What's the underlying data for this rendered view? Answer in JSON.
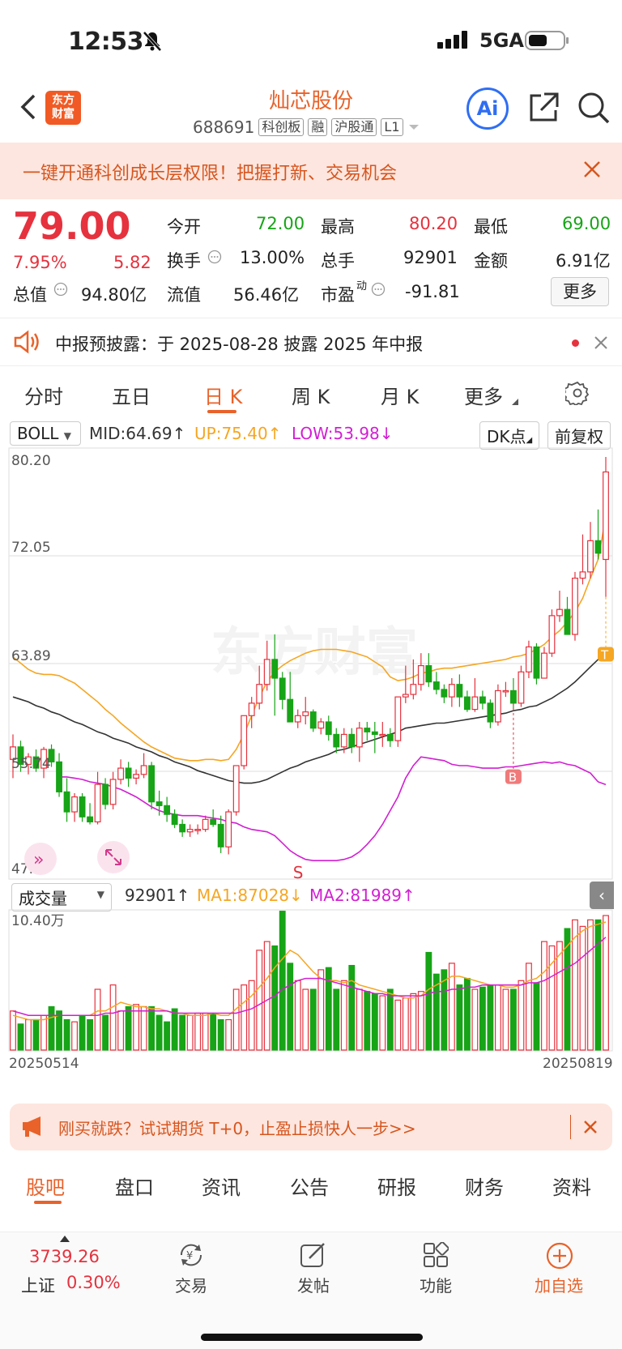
{
  "status": {
    "time": "12:53",
    "network": "5GA"
  },
  "nav": {
    "title": "灿芯股份",
    "code": "688691",
    "tags": [
      "科创板",
      "融",
      "沪股通",
      "L1"
    ],
    "logo": [
      "东方",
      "财富"
    ],
    "ai": "Ai"
  },
  "promo": {
    "text": "一键开通科创成长层权限！把握打新、交易机会"
  },
  "quote": {
    "price": "79.00",
    "pct": "7.95%",
    "chg": "5.82",
    "open_label": "今开",
    "open": "72.00",
    "high_label": "最高",
    "high": "80.20",
    "low_label": "最低",
    "low": "69.00",
    "turnover_label": "换手",
    "turnover": "13.00%",
    "vol_label": "总手",
    "vol": "92901",
    "amount_label": "金额",
    "amount": "6.91亿",
    "mktcap_label": "总值",
    "mktcap": "94.80亿",
    "float_label": "流值",
    "float": "56.46亿",
    "pe_label": "市盈",
    "pe_sup": "动",
    "pe": "-91.81",
    "more": "更多"
  },
  "notice": {
    "text": "中报预披露：于 2025-08-28 披露 2025 年中报"
  },
  "tabs": [
    "分时",
    "五日",
    "日 K",
    "周 K",
    "月 K",
    "更多"
  ],
  "indicator": {
    "name": "BOLL",
    "mid": "MID:64.69",
    "up": "UP:75.40",
    "low": "LOW:53.98",
    "dk": "DK点",
    "fq": "前复权"
  },
  "axis": {
    "y1": "80.20",
    "y2": "72.05",
    "y3": "63.89",
    "y4": "55.74",
    "y5": "47.59"
  },
  "marks": {
    "s": "S",
    "b": "B",
    "t": "T"
  },
  "watermark": "东方财富",
  "volume": {
    "name": "成交量",
    "val": "92901",
    "ma1": "MA1:87028",
    "ma2": "MA2:81989",
    "max": "10.40万",
    "start": "20250514",
    "end": "20250819"
  },
  "banner2": {
    "text": "刚买就跌？试试期货 T+0，止盈止损快人一步>>"
  },
  "bottom_tabs": [
    "股吧",
    "盘口",
    "资讯",
    "公告",
    "研报",
    "财务",
    "资料"
  ],
  "footer": {
    "index_val": "3739.26",
    "index_name": "上证",
    "index_pct": "0.30%",
    "trade": "交易",
    "post": "发帖",
    "func": "功能",
    "add": "加自选"
  },
  "colors": {
    "accent": "#e8622a",
    "up": "#e5323e",
    "down": "#17a417",
    "mid": "#333333",
    "upper": "#f5a623",
    "lower": "#d21fd2"
  },
  "chart_data": {
    "type": "candlestick",
    "ylim": [
      47.59,
      80.2
    ],
    "candles": [
      [
        56,
        58,
        54.5,
        57
      ],
      [
        57,
        57.5,
        55,
        55.6
      ],
      [
        55.6,
        56.5,
        54.8,
        56.2
      ],
      [
        56.2,
        56.8,
        55,
        55.3
      ],
      [
        55.3,
        57,
        54.5,
        56.8
      ],
      [
        56.8,
        57.2,
        55.4,
        55.8
      ],
      [
        55.8,
        56.5,
        53,
        53.4
      ],
      [
        53.4,
        54.5,
        51,
        51.8
      ],
      [
        51.8,
        53.3,
        51,
        53
      ],
      [
        53,
        53.3,
        51,
        51.4
      ],
      [
        51.4,
        52.5,
        50.8,
        51
      ],
      [
        51,
        55,
        50.8,
        54
      ],
      [
        54,
        54.5,
        52,
        52.4
      ],
      [
        52.4,
        55,
        52,
        54.4
      ],
      [
        54.4,
        56,
        54,
        55.3
      ],
      [
        55.3,
        55.8,
        53.8,
        54.5
      ],
      [
        54.5,
        55.2,
        54,
        54.8
      ],
      [
        54.8,
        56.5,
        54.5,
        55.5
      ],
      [
        55.5,
        55.8,
        52,
        52.6
      ],
      [
        52.6,
        53.5,
        51.5,
        52.3
      ],
      [
        52.3,
        53,
        51,
        51.6
      ],
      [
        51.6,
        52,
        50.5,
        50.8
      ],
      [
        50.8,
        51.2,
        49.8,
        50.2
      ],
      [
        50.2,
        50.8,
        49.8,
        50.4
      ],
      [
        50.4,
        50.8,
        50,
        50.4
      ],
      [
        50.4,
        51.5,
        50.2,
        51.2
      ],
      [
        51.2,
        52,
        50.6,
        50.8
      ],
      [
        50.8,
        51.5,
        48.5,
        49
      ],
      [
        49,
        52,
        48.4,
        51.8
      ],
      [
        51.8,
        55.5,
        51.5,
        55.5
      ],
      [
        55.5,
        59.5,
        55.2,
        59.5
      ],
      [
        59.5,
        61,
        58.5,
        60.5
      ],
      [
        60.5,
        63.5,
        60,
        62
      ],
      [
        62,
        65.5,
        61.5,
        64
      ],
      [
        64,
        66,
        59.5,
        62.5
      ],
      [
        62.5,
        63,
        60,
        60.8
      ],
      [
        60.8,
        63,
        60,
        59
      ],
      [
        59,
        60,
        58.5,
        59.5
      ],
      [
        59.5,
        61,
        58.8,
        59.8
      ],
      [
        59.8,
        60,
        58.2,
        58.5
      ],
      [
        58.5,
        59.3,
        58,
        59
      ],
      [
        59,
        59.5,
        57.5,
        58
      ],
      [
        58,
        58.5,
        56.5,
        57
      ],
      [
        57,
        58.5,
        56.5,
        58
      ],
      [
        58,
        58.5,
        56.5,
        57
      ],
      [
        57,
        59,
        55.8,
        58.5
      ],
      [
        58.5,
        59,
        57.5,
        58.2
      ],
      [
        58.2,
        59,
        56.5,
        58
      ],
      [
        58,
        59,
        57,
        58
      ],
      [
        58,
        58.5,
        57,
        57.5
      ],
      [
        57.5,
        61,
        57,
        61
      ],
      [
        61,
        63.5,
        60.5,
        61.2
      ],
      [
        61.2,
        64,
        60.8,
        62
      ],
      [
        62,
        64.5,
        61.5,
        63.5
      ],
      [
        63.5,
        64.5,
        61.8,
        62.2
      ],
      [
        62.2,
        63,
        61.2,
        61.6
      ],
      [
        61.6,
        62,
        60.5,
        61
      ],
      [
        61,
        62.5,
        60.2,
        62
      ],
      [
        62,
        62.8,
        60.2,
        61
      ],
      [
        61,
        61.5,
        59.8,
        60
      ],
      [
        60,
        62.5,
        59.8,
        61
      ],
      [
        61,
        61.5,
        60,
        60.5
      ],
      [
        60.5,
        60.8,
        58.5,
        59
      ],
      [
        59,
        62,
        58.7,
        61.5
      ],
      [
        61.5,
        62.2,
        61,
        61.5
      ],
      [
        61.5,
        62.5,
        60,
        60.5
      ],
      [
        60.5,
        63.5,
        60.2,
        63
      ],
      [
        63,
        65.5,
        62.5,
        65
      ],
      [
        65,
        65.3,
        62,
        62.5
      ],
      [
        62.5,
        65,
        62.5,
        64.5
      ],
      [
        64.5,
        68,
        64.2,
        67.5
      ],
      [
        67.5,
        69.5,
        67,
        68
      ],
      [
        68,
        69,
        66,
        66
      ],
      [
        66,
        71,
        65.5,
        70.5
      ],
      [
        70.5,
        74,
        70,
        71
      ],
      [
        71,
        75,
        70.5,
        73.5
      ],
      [
        73.5,
        76,
        72,
        72.5
      ],
      [
        72,
        80.2,
        69,
        79
      ]
    ],
    "mid": [
      61.0,
      60.8,
      60.6,
      60.3,
      60.1,
      59.8,
      59.6,
      59.3,
      59.0,
      58.8,
      58.5,
      58.2,
      58.0,
      57.7,
      57.5,
      57.3,
      57.0,
      56.8,
      56.6,
      56.3,
      56.1,
      55.8,
      55.6,
      55.4,
      55.1,
      54.9,
      54.7,
      54.5,
      54.3,
      54.2,
      54.1,
      54.1,
      54.2,
      54.4,
      54.7,
      55.0,
      55.3,
      55.5,
      55.8,
      56.0,
      56.2,
      56.4,
      56.7,
      56.8,
      57.0,
      57.2,
      57.4,
      57.6,
      57.8,
      58.0,
      58.2,
      58.5,
      58.6,
      58.7,
      58.8,
      58.9,
      58.9,
      59.0,
      59.1,
      59.2,
      59.3,
      59.4,
      59.5,
      59.6,
      59.7,
      59.9,
      60.0,
      60.2,
      60.3,
      60.6,
      60.9,
      61.3,
      61.7,
      62.2,
      62.8,
      63.4,
      64.0,
      64.69
    ],
    "upper": [
      64.2,
      63.7,
      63.2,
      62.9,
      62.8,
      62.8,
      62.7,
      62.4,
      62.1,
      61.6,
      61.1,
      60.6,
      60.0,
      59.5,
      58.9,
      58.4,
      57.9,
      57.4,
      57.0,
      56.7,
      56.4,
      56.1,
      56.0,
      55.9,
      55.9,
      56.0,
      56.0,
      55.9,
      56.0,
      56.8,
      58.0,
      59.5,
      61.0,
      62.2,
      63.0,
      63.5,
      63.9,
      64.2,
      64.5,
      64.7,
      64.8,
      64.8,
      64.8,
      64.7,
      64.6,
      64.4,
      64.2,
      63.8,
      63.4,
      62.6,
      62.3,
      62.4,
      62.6,
      62.9,
      63.0,
      63.2,
      63.3,
      63.3,
      63.4,
      63.5,
      63.6,
      63.7,
      63.8,
      63.9,
      64.0,
      64.2,
      64.3,
      64.5,
      64.8,
      65.2,
      65.8,
      66.3,
      67.0,
      67.8,
      68.9,
      70.5,
      72.0,
      75.4
    ],
    "lower": [
      54.6,
      54.6,
      54.5,
      54.4,
      54.2,
      54.1,
      54.0,
      53.8,
      53.6,
      53.3,
      53.0,
      52.6,
      52.2,
      51.9,
      51.7,
      51.6,
      51.5,
      51.5,
      51.5,
      51.4,
      51.3,
      51.2,
      51.0,
      50.9,
      50.6,
      50.4,
      50.3,
      50.2,
      49.9,
      49.3,
      48.7,
      48.3,
      48.0,
      47.9,
      47.9,
      47.9,
      47.9,
      48.0,
      48.2,
      48.6,
      49.2,
      49.9,
      50.8,
      51.9,
      53.0,
      54.5,
      55.5,
      56.2,
      56.1,
      56.0,
      55.9,
      55.6,
      55.5,
      55.5,
      55.4,
      55.3,
      55.3,
      55.3,
      55.4,
      55.4,
      55.5,
      55.6,
      55.7,
      55.8,
      55.7,
      55.8,
      55.6,
      55.5,
      55.2,
      54.9,
      54.2,
      53.98
    ],
    "volumes": [
      18,
      12,
      14,
      14,
      16,
      20,
      18,
      14,
      13,
      16,
      14,
      28,
      16,
      30,
      18,
      20,
      21,
      20,
      20,
      16,
      13,
      19,
      16,
      16,
      17,
      17,
      17,
      14,
      14,
      28,
      30,
      32,
      46,
      50,
      48,
      64,
      40,
      32,
      28,
      28,
      37,
      38,
      28,
      32,
      39,
      28,
      27,
      26,
      25,
      28,
      23,
      24,
      26,
      27,
      45,
      35,
      37,
      40,
      30,
      33,
      28,
      29,
      30,
      30,
      28,
      28,
      32,
      40,
      31,
      50,
      48,
      50,
      56,
      60,
      57,
      60,
      60,
      62
    ],
    "ma1": [
      16,
      15,
      14,
      14,
      14,
      15,
      16,
      16,
      16,
      16,
      16,
      18,
      18,
      20,
      22,
      21,
      20,
      20,
      19,
      19,
      18,
      17,
      17,
      16,
      16,
      16,
      17,
      16,
      16,
      19,
      22,
      25,
      29,
      33,
      38,
      42,
      46,
      44,
      40,
      36,
      33,
      32,
      32,
      31,
      32,
      30,
      29,
      28,
      27,
      26,
      25,
      24,
      24,
      25,
      28,
      30,
      32,
      34,
      34,
      33,
      32,
      31,
      30,
      30,
      29,
      29,
      30,
      32,
      33,
      36,
      40,
      44,
      48,
      52,
      55,
      57,
      58,
      59
    ],
    "ma2": [
      18,
      17,
      16,
      16,
      16,
      16,
      16,
      16,
      16,
      16,
      16,
      16,
      17,
      17,
      18,
      18,
      18,
      18,
      18,
      18,
      18,
      17,
      17,
      17,
      17,
      17,
      17,
      17,
      17,
      17,
      18,
      19,
      21,
      23,
      25,
      28,
      30,
      32,
      33,
      33,
      33,
      32,
      31,
      30,
      29,
      28,
      27,
      26,
      26,
      25,
      25,
      25,
      25,
      25,
      26,
      27,
      27,
      28,
      28,
      29,
      29,
      30,
      30,
      30,
      30,
      30,
      30,
      31,
      31,
      32,
      34,
      36,
      38,
      40,
      43,
      46,
      49,
      52
    ]
  }
}
